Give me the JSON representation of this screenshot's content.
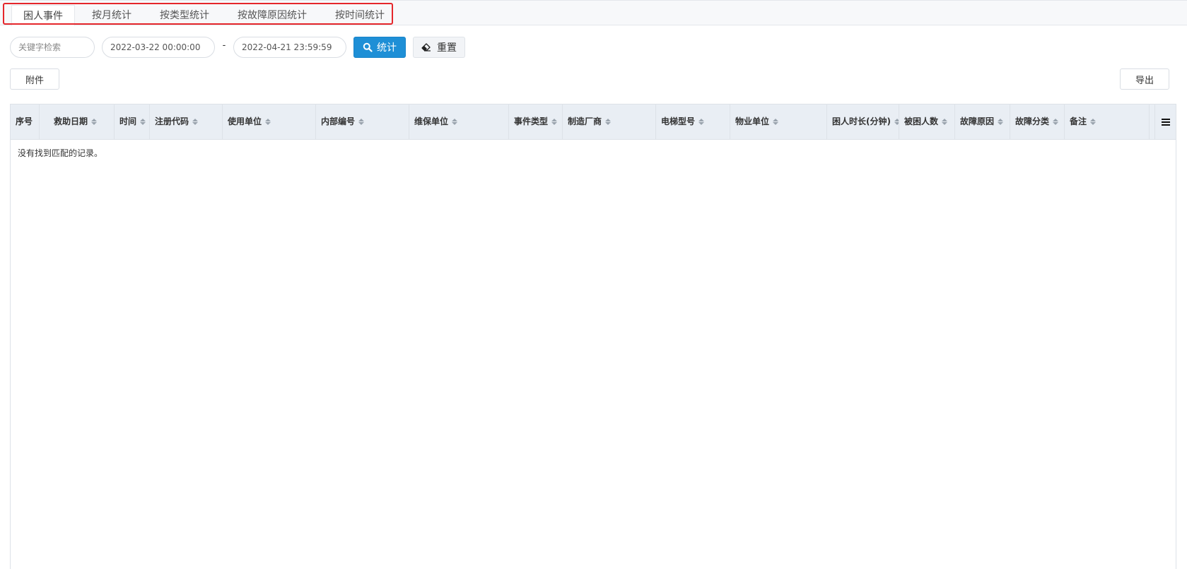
{
  "tabs": [
    {
      "label": "困人事件",
      "active": true
    },
    {
      "label": "按月统计",
      "active": false
    },
    {
      "label": "按类型统计",
      "active": false
    },
    {
      "label": "按故障原因统计",
      "active": false
    },
    {
      "label": "按时间统计",
      "active": false
    }
  ],
  "filters": {
    "keyword_placeholder": "关键字检索",
    "date_start": "2022-03-22 00:00:00",
    "separator": "-",
    "date_end": "2022-04-21 23:59:59",
    "stat_button": "统计",
    "reset_button": "重置"
  },
  "toolbar": {
    "attach_button": "附件",
    "export_button": "导出"
  },
  "table": {
    "columns": [
      {
        "label": "序号",
        "sortable": false
      },
      {
        "label": "救助日期",
        "sortable": true
      },
      {
        "label": "时间",
        "sortable": true
      },
      {
        "label": "注册代码",
        "sortable": true
      },
      {
        "label": "使用单位",
        "sortable": true
      },
      {
        "label": "内部编号",
        "sortable": true
      },
      {
        "label": "维保单位",
        "sortable": true
      },
      {
        "label": "事件类型",
        "sortable": true
      },
      {
        "label": "制造厂商",
        "sortable": true
      },
      {
        "label": "电梯型号",
        "sortable": true
      },
      {
        "label": "物业单位",
        "sortable": true
      },
      {
        "label": "困人时长(分钟)",
        "sortable": true
      },
      {
        "label": "被困人数",
        "sortable": true
      },
      {
        "label": "故障原因",
        "sortable": true
      },
      {
        "label": "故障分类",
        "sortable": true
      },
      {
        "label": "备注",
        "sortable": true
      }
    ],
    "empty_text": "没有找到匹配的记录。"
  },
  "colors": {
    "primary": "#1e8fd6",
    "highlight_box": "#e5262b",
    "header_bg": "#e9eef4"
  }
}
